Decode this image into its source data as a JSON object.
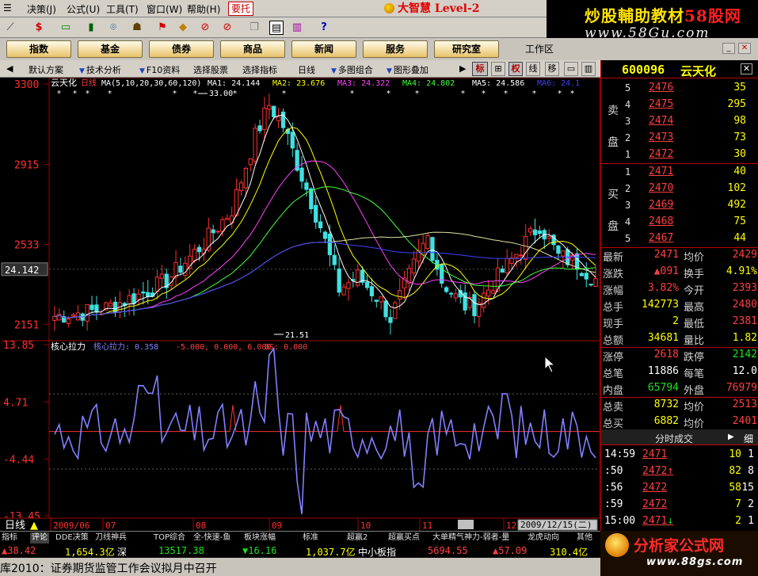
{
  "menu": {
    "items": [
      "决策(J)",
      "公式(U)",
      "工具(T)",
      "窗口(W)",
      "帮助(H)"
    ],
    "alert": "要托",
    "brand": "大智慧 Level-2"
  },
  "watermark_top": {
    "line1_a": "炒股輔助教材",
    "line1_b": "58股网",
    "line2": "www.58Gu.com"
  },
  "modules": {
    "tabs": [
      "指数",
      "基金",
      "债券",
      "商品",
      "新闻",
      "服务",
      "研究室"
    ],
    "workarea": "工作区"
  },
  "chart_toolbar": {
    "scheme": "默认方案",
    "tech": "技术分析",
    "f10": "F10资料",
    "select_stock": "选择股票",
    "select_indicator": "选择指标",
    "period": "日线",
    "multi": "多图组合",
    "overlay": "图形叠加",
    "btn_biao": "标",
    "btn_quan": "权",
    "btn_xian": "线",
    "btn_yi": "移"
  },
  "chart_header": {
    "name": "云天化",
    "period": "日线",
    "ma_def": "MA(5,10,20,30,60,120)",
    "ma1": "MA1: 24.144",
    "ma2": "MA2: 23.676",
    "ma3": "MA3: 24.322",
    "ma4": "MA4: 24.802",
    "ma5": "MA5: 24.586",
    "ma6": "MA6: 24.1"
  },
  "price_axis": {
    "labels": [
      "3300",
      "2915",
      "2533",
      "2151"
    ],
    "current": "24.142"
  },
  "price_annotations": {
    "high": "33.00",
    "low": "21.51"
  },
  "indicator": {
    "name": "核心拉力",
    "header": "核心拉力: 0.358",
    "params": "-5.000, 0.000, 6.000,",
    "bs": "BS: 0.000",
    "axis": [
      "13.85",
      "4.71",
      "-4.44",
      "-13.45"
    ]
  },
  "date_axis": {
    "period": "日线",
    "labels": [
      "2009/06",
      "07",
      "08",
      "09",
      "10",
      "11",
      "12"
    ],
    "cursor": "2009/12/15(二)"
  },
  "quote": {
    "code": "600096",
    "name": "云天化",
    "sell_label": [
      "卖",
      "盘"
    ],
    "buy_label": [
      "买",
      "盘"
    ],
    "asks": [
      {
        "lv": "5",
        "price": "2476",
        "vol": "35"
      },
      {
        "lv": "4",
        "price": "2475",
        "vol": "295"
      },
      {
        "lv": "3",
        "price": "2474",
        "vol": "98"
      },
      {
        "lv": "2",
        "price": "2473",
        "vol": "73"
      },
      {
        "lv": "1",
        "price": "2472",
        "vol": "30"
      }
    ],
    "bids": [
      {
        "lv": "1",
        "price": "2471",
        "vol": "40"
      },
      {
        "lv": "2",
        "price": "2470",
        "vol": "102"
      },
      {
        "lv": "3",
        "price": "2469",
        "vol": "492"
      },
      {
        "lv": "4",
        "price": "2468",
        "vol": "75"
      },
      {
        "lv": "5",
        "price": "2467",
        "vol": "44"
      }
    ],
    "stats": [
      {
        "k1": "最新",
        "v1": "2471",
        "c1": "red",
        "k2": "均价",
        "v2": "2429",
        "c2": "red"
      },
      {
        "k1": "涨跌",
        "v1": "▲091",
        "c1": "red",
        "k2": "换手",
        "v2": "4.91%",
        "c2": "yel"
      },
      {
        "k1": "涨幅",
        "v1": "3.82%",
        "c1": "red",
        "k2": "今开",
        "v2": "2393",
        "c2": "red"
      },
      {
        "k1": "总手",
        "v1": "142773",
        "c1": "yel",
        "k2": "最高",
        "v2": "2480",
        "c2": "red"
      },
      {
        "k1": "现手",
        "v1": "2",
        "c1": "yel",
        "k2": "最低",
        "v2": "2381",
        "c2": "red"
      },
      {
        "k1": "总额",
        "v1": "34681",
        "c1": "yel",
        "k2": "量比",
        "v2": "1.82",
        "c2": "yel"
      },
      {
        "k1": "涨停",
        "v1": "2618",
        "c1": "red",
        "k2": "跌停",
        "v2": "2142",
        "c2": "grn"
      },
      {
        "k1": "总笔",
        "v1": "11886",
        "c1": "wht",
        "k2": "每笔",
        "v2": "12.0",
        "c2": "wht"
      },
      {
        "k1": "内盘",
        "v1": "65794",
        "c1": "grn",
        "k2": "外盘",
        "v2": "76979",
        "c2": "red"
      },
      {
        "k1": "总卖",
        "v1": "8732",
        "c1": "yel",
        "k2": "均价",
        "v2": "2513",
        "c2": "red"
      },
      {
        "k1": "总买",
        "v1": "6882",
        "c1": "yel",
        "k2": "均价",
        "v2": "2401",
        "c2": "red"
      }
    ],
    "ticks_title": "分时成交",
    "ticks_extra": "细",
    "ticks": [
      {
        "t": "14:59",
        "p": "2471",
        "arrow": "",
        "v": "10",
        "n": "1"
      },
      {
        "t": ":50",
        "p": "2472",
        "arrow": "↑",
        "v": "82",
        "n": "8"
      },
      {
        "t": ":56",
        "p": "2472",
        "arrow": "",
        "v": "58",
        "n": "15"
      },
      {
        "t": ":59",
        "p": "2472",
        "arrow": "",
        "v": "7",
        "n": "2"
      },
      {
        "t": "15:00",
        "p": "2471",
        "arrow": "↓",
        "v": "2",
        "n": "1"
      }
    ]
  },
  "bottom_tabs": [
    "指标",
    "评论",
    "DDE决策",
    "刀线神兵",
    "TOP综合",
    "全-快速-鱼",
    "板块涨幅",
    "标准",
    "超赢2",
    "超赢买点",
    "大单精气神力-弱者-量",
    "龙虎动向",
    "其他"
  ],
  "index_bar": [
    {
      "text": "▲38.42",
      "c": "red"
    },
    {
      "text": "1,654.3亿",
      "c": "yel"
    },
    {
      "text": "深",
      "c": "wht"
    },
    {
      "text": "13517.38",
      "c": "grn"
    },
    {
      "text": "▼16.16",
      "c": "grn"
    },
    {
      "text": "1,037.7亿",
      "c": "yel"
    },
    {
      "text": "中小板指",
      "c": "wht"
    },
    {
      "text": "5694.55",
      "c": "red"
    },
    {
      "text": "▲57.09",
      "c": "red"
    },
    {
      "text": "310.4亿",
      "c": "yel"
    }
  ],
  "news": "库2010：证券期货监管工作会议拟月中召开",
  "watermark_bot": {
    "line1": "分析家公式网",
    "line2": "www.88gs.com"
  },
  "colors": {
    "up": "#ff3030",
    "down": "#40e0e0",
    "indicator": "#8080ff",
    "grid": "#a00000"
  }
}
